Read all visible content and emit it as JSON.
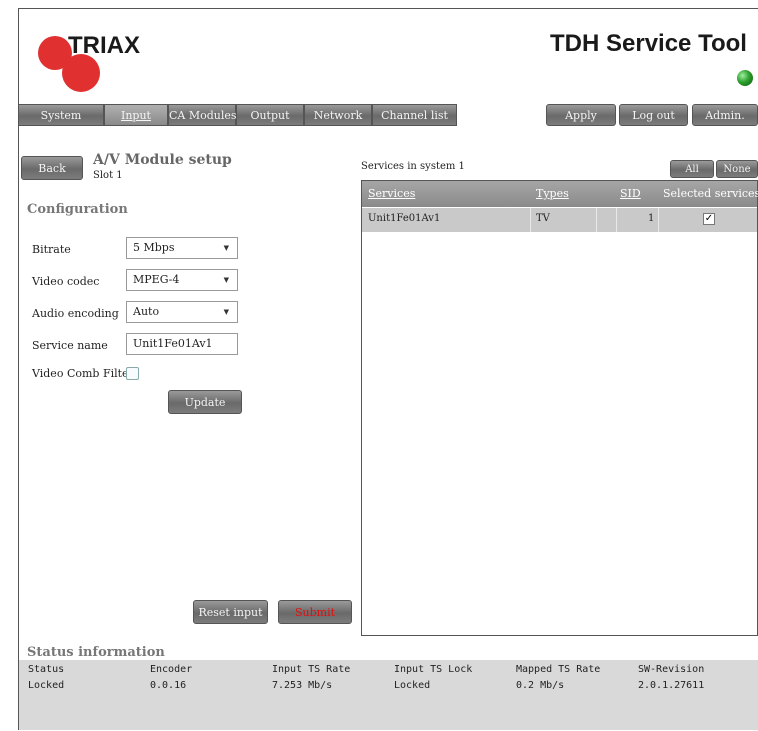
{
  "header": {
    "logo_text": "TRIAX",
    "app_title": "TDH Service Tool",
    "status_led_color": "#2ea02e"
  },
  "nav": {
    "tabs": [
      {
        "label": "System"
      },
      {
        "label": "Input",
        "active": true
      },
      {
        "label": "CA Modules"
      },
      {
        "label": "Output"
      },
      {
        "label": "Network"
      },
      {
        "label": "Channel list"
      }
    ],
    "actions": {
      "apply": "Apply",
      "logout": "Log out",
      "admin": "Admin."
    }
  },
  "page": {
    "back_label": "Back",
    "title": "A/V Module setup",
    "subtitle": "Slot 1",
    "section": "Configuration"
  },
  "form": {
    "bitrate_label": "Bitrate",
    "bitrate_value": "5 Mbps",
    "codec_label": "Video codec",
    "codec_value": "MPEG-4",
    "audio_label": "Audio encoding",
    "audio_value": "Auto",
    "name_label": "Service name",
    "name_value": "Unit1Fe01Av1",
    "comb_label": "Video Comb Filter",
    "update_label": "Update",
    "reset_label": "Reset input",
    "submit_label": "Submit"
  },
  "services": {
    "caption": "Services in system 1",
    "all_label": "All",
    "none_label": "None",
    "columns": {
      "name": "Services",
      "type": "Types",
      "sid": "SID",
      "selected": "Selected services"
    },
    "rows": [
      {
        "name": "Unit1Fe01Av1",
        "type": "TV",
        "sid": "1",
        "selected": true,
        "check": "✓"
      }
    ]
  },
  "status": {
    "title": "Status information",
    "items": [
      {
        "label": "Status",
        "value": "Locked"
      },
      {
        "label": "Encoder",
        "value": "0.0.16"
      },
      {
        "label": "Input TS Rate",
        "value": "7.253 Mb/s"
      },
      {
        "label": "Input TS Lock",
        "value": "Locked"
      },
      {
        "label": "Mapped TS Rate",
        "value": "0.2 Mb/s"
      },
      {
        "label": "SW-Revision",
        "value": "2.0.1.27611"
      }
    ]
  }
}
